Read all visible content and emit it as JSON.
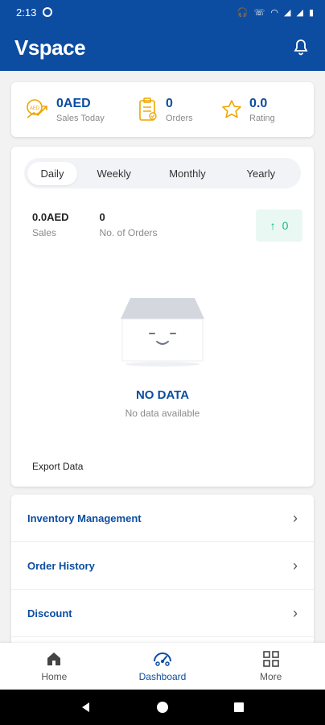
{
  "statusbar": {
    "time": "2:13"
  },
  "appbar": {
    "logo": "Vspace"
  },
  "stats": {
    "sales_value": "0AED",
    "sales_label": "Sales Today",
    "orders_value": "0",
    "orders_label": "Orders",
    "rating_value": "0.0",
    "rating_label": "Rating"
  },
  "tabs": [
    "Daily",
    "Weekly",
    "Monthly",
    "Yearly"
  ],
  "summary": {
    "sales_value": "0.0AED",
    "sales_label": "Sales",
    "orders_value": "0",
    "orders_label": "No. of Orders",
    "trend_value": "0"
  },
  "empty": {
    "title": "NO DATA",
    "subtitle": "No data available"
  },
  "export_label": "Export Data",
  "menu": [
    "Inventory Management",
    "Order History",
    "Discount"
  ],
  "bottomnav": {
    "home": "Home",
    "dashboard": "Dashboard",
    "more": "More"
  },
  "colors": {
    "primary": "#0c4da2",
    "accent": "#f0a500",
    "trend": "#1fb584"
  }
}
